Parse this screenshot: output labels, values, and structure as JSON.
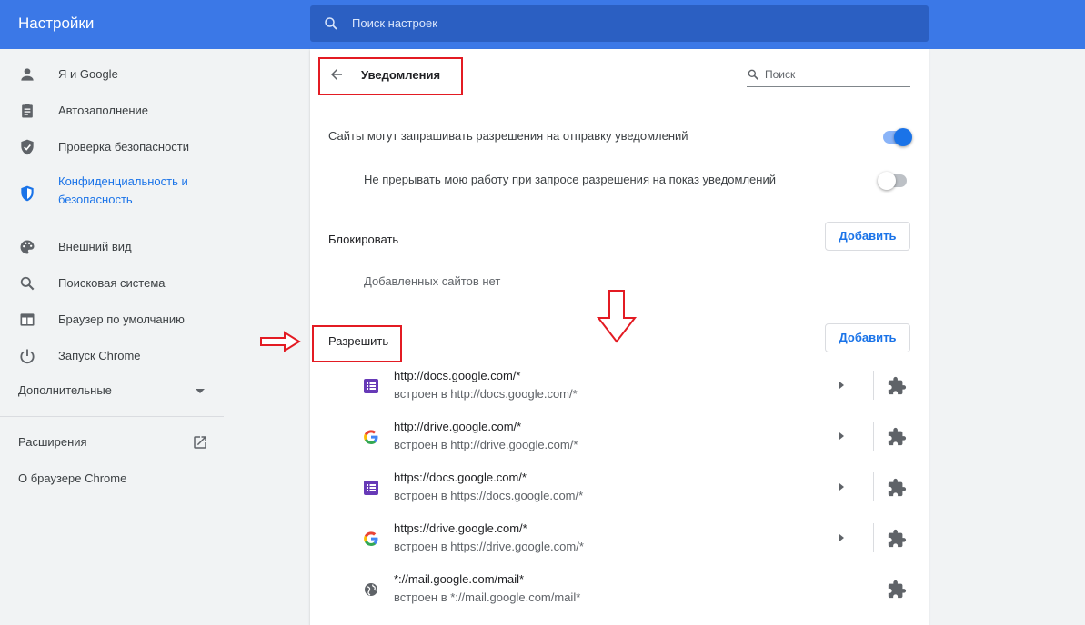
{
  "header": {
    "app_title": "Настройки",
    "search_placeholder": "Поиск настроек"
  },
  "sidebar": {
    "items": [
      {
        "label": "Я и Google",
        "icon": "person-icon"
      },
      {
        "label": "Автозаполнение",
        "icon": "clipboard-icon"
      },
      {
        "label": "Проверка безопасности",
        "icon": "shield-icon"
      },
      {
        "label": "Конфиденциальность и безопасность",
        "label_line1": "Конфиденциальность и",
        "label_line2": "безопасность",
        "icon": "shield-half-icon",
        "active": true
      },
      {
        "label": "Внешний вид",
        "icon": "palette-icon"
      },
      {
        "label": "Поисковая система",
        "icon": "search-icon"
      },
      {
        "label": "Браузер по умолчанию",
        "icon": "browser-icon"
      },
      {
        "label": "Запуск Chrome",
        "icon": "power-icon"
      }
    ],
    "advanced_label": "Дополнительные",
    "extensions_label": "Расширения",
    "about_label": "О браузере Chrome"
  },
  "page": {
    "title": "Уведомления",
    "search_placeholder": "Поиск",
    "ask_setting": {
      "label": "Сайты могут запрашивать разрешения на отправку уведомлений",
      "enabled": true
    },
    "quiet_setting": {
      "label": "Не прерывать мою работу при запросе разрешения на показ уведомлений",
      "enabled": false
    },
    "block": {
      "heading": "Блокировать",
      "add_label": "Добавить",
      "empty_text": "Добавленных сайтов нет"
    },
    "allow": {
      "heading": "Разрешить",
      "add_label": "Добавить",
      "sites": [
        {
          "origin": "http://docs.google.com/*",
          "embedded": "встроен в http://docs.google.com/*",
          "favicon": "forms-icon"
        },
        {
          "origin": "http://drive.google.com/*",
          "embedded": "встроен в http://drive.google.com/*",
          "favicon": "google-g-icon"
        },
        {
          "origin": "https://docs.google.com/*",
          "embedded": "встроен в https://docs.google.com/*",
          "favicon": "forms-icon"
        },
        {
          "origin": "https://drive.google.com/*",
          "embedded": "встроен в https://drive.google.com/*",
          "favicon": "google-g-icon"
        },
        {
          "origin": "*://mail.google.com/mail*",
          "embedded": "встроен в *://mail.google.com/mail*",
          "favicon": "globe-icon"
        }
      ]
    }
  },
  "colors": {
    "header_bg": "#3b78e7",
    "accent": "#1a73e8",
    "annotation_red": "#e31b23"
  }
}
